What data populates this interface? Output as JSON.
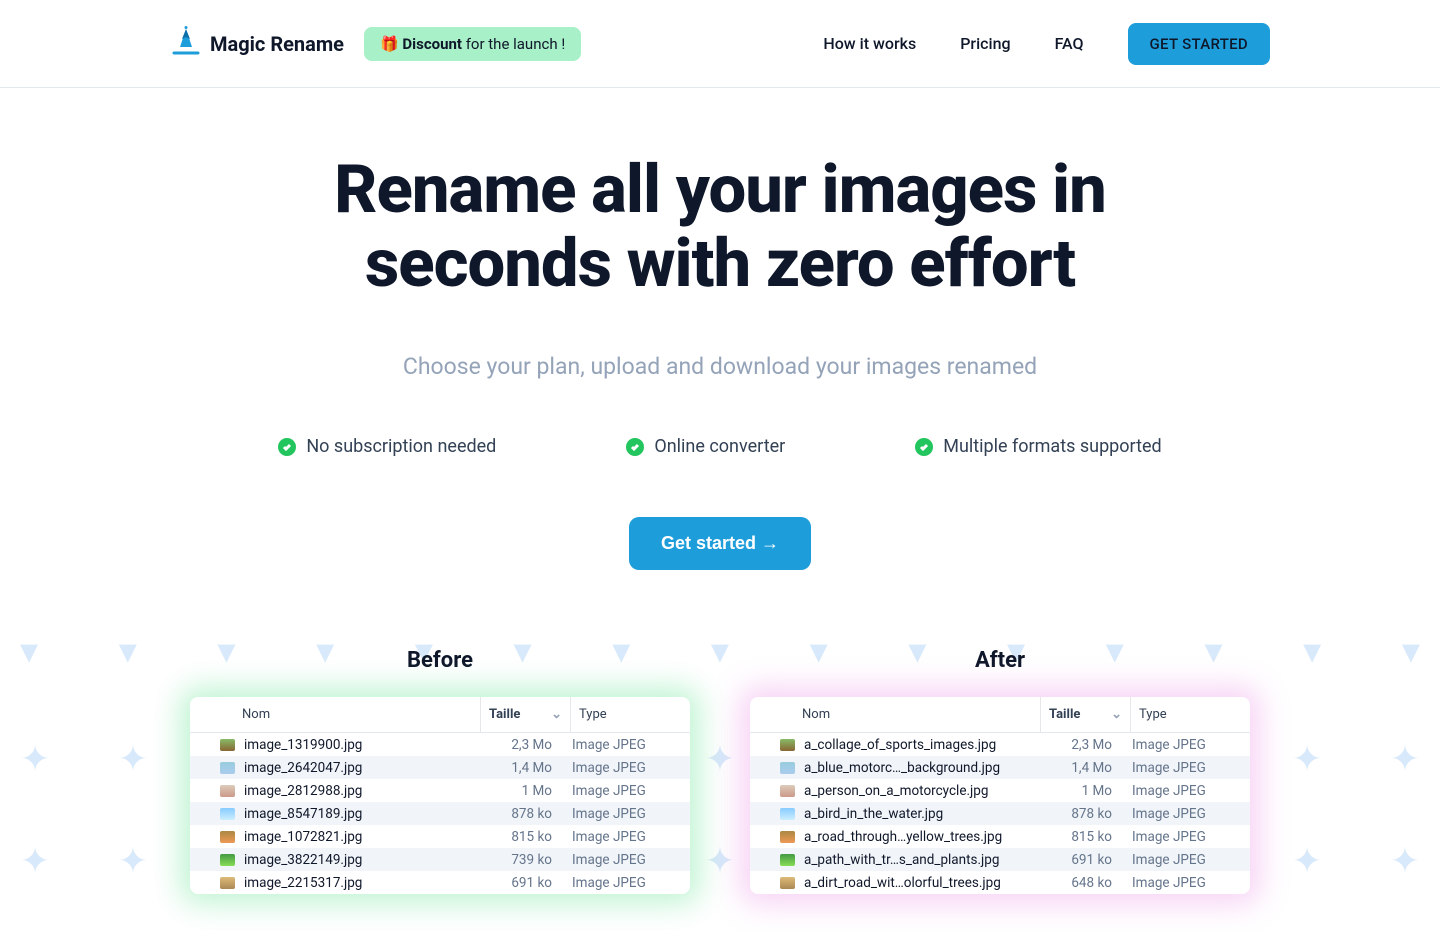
{
  "header": {
    "brand": "Magic Rename",
    "discount_prefix": "🎁 ",
    "discount_bold": "Discount",
    "discount_rest": " for the launch !",
    "nav": {
      "how": "How it works",
      "pricing": "Pricing",
      "faq": "FAQ"
    },
    "cta": "GET STARTED"
  },
  "hero": {
    "title": "Rename all your images in seconds with zero effort",
    "subtitle": "Choose your plan, upload and download your images renamed",
    "features": {
      "feat1": "No subscription needed",
      "feat2": "Online converter",
      "feat3": "Multiple formats supported"
    },
    "cta": "Get started →"
  },
  "ba": {
    "before_label": "Before",
    "after_label": "After",
    "cols": {
      "nom": "Nom",
      "taille": "Taille",
      "type": "Type"
    },
    "before": {
      "r0": {
        "name": "image_1319900.jpg",
        "size": "2,3 Mo",
        "type": "Image JPEG"
      },
      "r1": {
        "name": "image_2642047.jpg",
        "size": "1,4 Mo",
        "type": "Image JPEG"
      },
      "r2": {
        "name": "image_2812988.jpg",
        "size": "1 Mo",
        "type": "Image JPEG"
      },
      "r3": {
        "name": "image_8547189.jpg",
        "size": "878 ko",
        "type": "Image JPEG"
      },
      "r4": {
        "name": "image_1072821.jpg",
        "size": "815 ko",
        "type": "Image JPEG"
      },
      "r5": {
        "name": "image_3822149.jpg",
        "size": "739 ko",
        "type": "Image JPEG"
      },
      "r6": {
        "name": "image_2215317.jpg",
        "size": "691 ko",
        "type": "Image JPEG"
      }
    },
    "after": {
      "r0": {
        "name": "a_collage_of_sports_images.jpg",
        "size": "2,3 Mo",
        "type": "Image JPEG"
      },
      "r1": {
        "name": "a_blue_motorc…_background.jpg",
        "size": "1,4 Mo",
        "type": "Image JPEG"
      },
      "r2": {
        "name": "a_person_on_a_motorcycle.jpg",
        "size": "1 Mo",
        "type": "Image JPEG"
      },
      "r3": {
        "name": "a_bird_in_the_water.jpg",
        "size": "878 ko",
        "type": "Image JPEG"
      },
      "r4": {
        "name": "a_road_through…yellow_trees.jpg",
        "size": "815 ko",
        "type": "Image JPEG"
      },
      "r5": {
        "name": "a_path_with_tr…s_and_plants.jpg",
        "size": "691 ko",
        "type": "Image JPEG"
      },
      "r6": {
        "name": "a_dirt_road_wit…olorful_trees.jpg",
        "size": "648 ko",
        "type": "Image JPEG"
      }
    }
  }
}
